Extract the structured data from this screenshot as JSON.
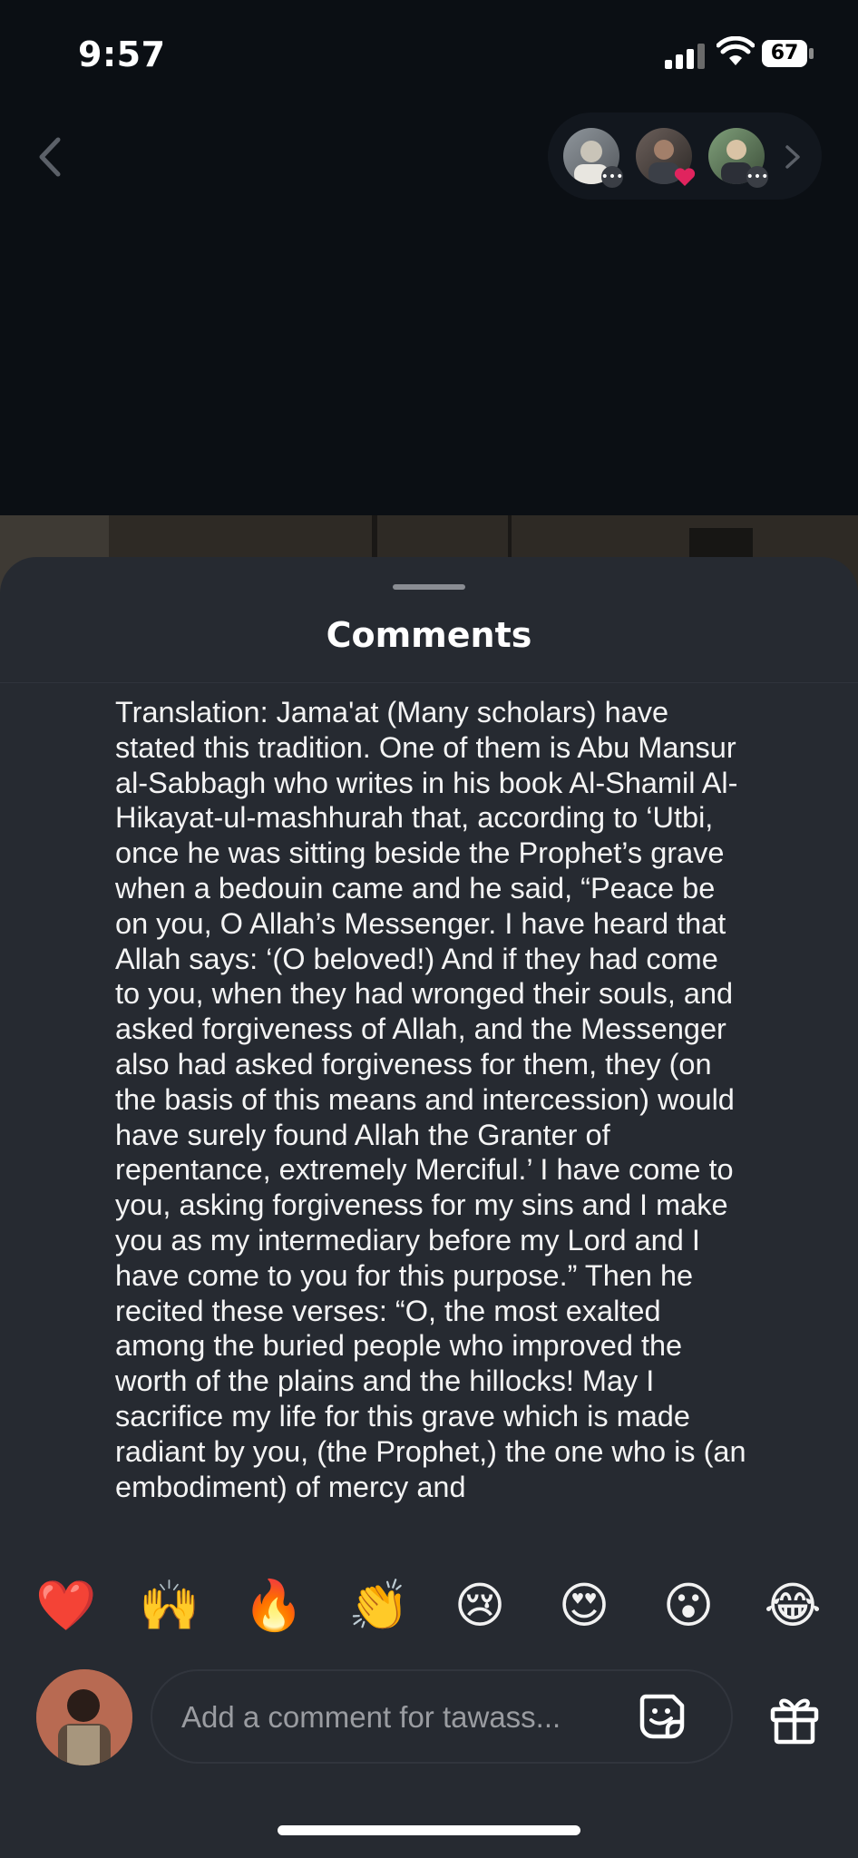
{
  "status_bar": {
    "time": "9:57",
    "battery": "67"
  },
  "story_header": {
    "avatars": [
      {
        "name": "story-avatar-1",
        "badge": "comment"
      },
      {
        "name": "story-avatar-2",
        "badge": "heart"
      },
      {
        "name": "story-avatar-3",
        "badge": "comment"
      }
    ]
  },
  "comments": {
    "title": "Comments",
    "body": "Translation: Jama'at (Many scholars) have stated this tradition. One of them is Abu Mansur al-Sabbagh who writes in his book Al-Shamil Al-Hikayat-ul-mashhurah that, according to ‘Utbi, once he was sitting beside the Prophet’s grave when a bedouin came and he said, “Peace be on you, O Allah’s Messenger. I have heard that Allah says: ‘(O beloved!) And if they had come to you, when they had wronged their souls, and asked forgiveness of Allah, and the Messenger also had asked forgiveness for them, they (on the basis of this means and intercession) would have surely found Allah the Granter of repentance, extremely Merciful.’ I have come to you, asking forgiveness for my sins and I make you as my intermediary before my Lord and I have come to you for this purpose.” Then he recited these verses: “O, the most exalted among the buried people who improved the worth of the plains and the hillocks! May I sacrifice my life for this grave which is made radiant by you, (the Prophet,) the one who is (an embodiment) of mercy and"
  },
  "reactions": [
    "❤️",
    "🙌",
    "🔥",
    "👏",
    "😢",
    "😍",
    "😮",
    "😂"
  ],
  "composer": {
    "placeholder": "Add a comment for tawass..."
  },
  "colors": {
    "sheet_bg": "#262a31",
    "top_bg": "#0b0f14",
    "heart_badge": "#e0245e"
  }
}
